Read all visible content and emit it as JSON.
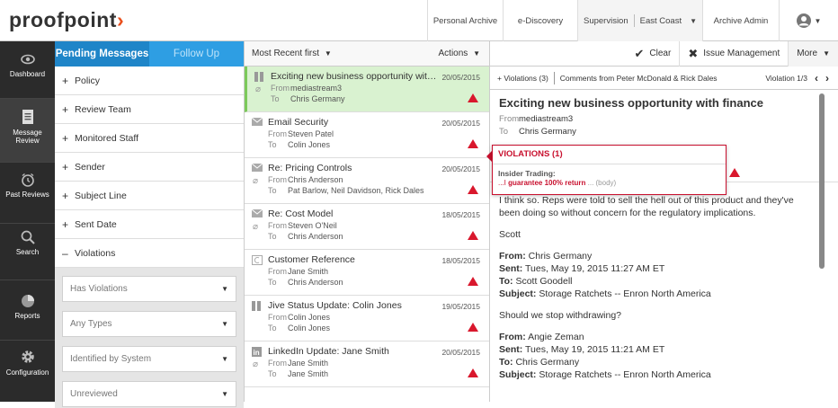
{
  "brand": {
    "name": "proofpoint",
    "mark": "›"
  },
  "topnav": {
    "personal_archive": "Personal Archive",
    "ediscovery": "e-Discovery",
    "supervision": "Supervision",
    "region": "East Coast",
    "archive_admin": "Archive Admin"
  },
  "leftnav": {
    "dashboard": "Dashboard",
    "message_review_1": "Message",
    "message_review_2": "Review",
    "past_reviews": "Past Reviews",
    "search": "Search",
    "reports": "Reports",
    "configuration": "Configuration"
  },
  "filters": {
    "tab_pending": "Pending Messages",
    "tab_followup": "Follow Up",
    "rows": [
      {
        "sign": "+",
        "label": "Policy"
      },
      {
        "sign": "+",
        "label": "Review Team"
      },
      {
        "sign": "+",
        "label": "Monitored Staff"
      },
      {
        "sign": "+",
        "label": "Sender"
      },
      {
        "sign": "+",
        "label": "Subject Line"
      },
      {
        "sign": "+",
        "label": "Sent Date"
      },
      {
        "sign": "–",
        "label": "Violations"
      }
    ],
    "selects": [
      "Has Violations",
      "Any Types",
      "Identified by System",
      "Unreviewed"
    ]
  },
  "list": {
    "sort": "Most Recent first",
    "actions": "Actions",
    "from_label": "From",
    "to_label": "To",
    "messages": [
      {
        "subject": "Exciting new business opportunity with fin...",
        "date": "20/05/2015",
        "from": "mediastream3",
        "to": "Chris Germany",
        "clip": true,
        "icon": "doc-icon"
      },
      {
        "subject": "Email Security",
        "date": "20/05/2015",
        "from": "Steven Patel",
        "to": "Colin Jones",
        "clip": false,
        "icon": "mail-icon"
      },
      {
        "subject": "Re: Pricing Controls",
        "date": "20/05/2015",
        "from": "Chris Anderson",
        "to": "Pat Barlow, Neil Davidson, Rick Dales",
        "clip": true,
        "icon": "mail-icon"
      },
      {
        "subject": "Re: Cost Model",
        "date": "18/05/2015",
        "from": "Steven O'Neil",
        "to": "Chris Anderson",
        "clip": true,
        "icon": "mail-icon"
      },
      {
        "subject": "Customer Reference",
        "date": "18/05/2015",
        "from": "Jane Smith",
        "to": "Chris Anderson",
        "clip": false,
        "icon": "chat-icon"
      },
      {
        "subject": "Jive Status Update: Colin Jones",
        "date": "19/05/2015",
        "from": "Colin Jones",
        "to": "Colin Jones",
        "clip": false,
        "icon": "doc-icon"
      },
      {
        "subject": "LinkedIn Update: Jane Smith",
        "date": "20/05/2015",
        "from": "Jane Smith",
        "to": "Jane Smith",
        "clip": true,
        "icon": "linkedin-icon"
      }
    ]
  },
  "toolbar": {
    "clear": "Clear",
    "issue": "Issue Management",
    "more": "More"
  },
  "reader": {
    "tab_violations": "+ Violations (3)",
    "tab_comments": "Comments from Peter McDonald & Rick Dales",
    "violation_counter": "Violation 1/3",
    "subject": "Exciting new business opportunity with finance",
    "from_label": "From",
    "to_label": "To",
    "from": "mediastream3",
    "to": "Chris Germany",
    "body": {
      "line1": "I think so. Reps were told to sell the hell out of this product and they've been doing so without concern for the regulatory implications.",
      "sign": "Scott",
      "f1_from_k": "From:",
      "f1_from_v": "Chris Germany",
      "f1_sent_k": "Sent:",
      "f1_sent_v": "Tues, May 19, 2015 11:27 AM ET",
      "f1_to_k": "To:",
      "f1_to_v": "Scott Goodell",
      "f1_subj_k": "Subject:",
      "f1_subj_v": "Storage Ratchets -- Enron North America",
      "question": "Should we stop withdrawing?",
      "f2_from_k": "From:",
      "f2_from_v": "Angie Zeman",
      "f2_sent_k": "Sent:",
      "f2_sent_v": "Tues, May 19, 2015 11:21 AM ET",
      "f2_to_k": "To:",
      "f2_to_v": "Chris Germany",
      "f2_subj_k": "Subject:",
      "f2_subj_v": "Storage Ratchets -- Enron North America"
    }
  },
  "popup": {
    "title": "VIOLATIONS (1)",
    "category": "Insider Trading:",
    "pre": "...I",
    "match": "guarantee 100% return",
    "post": "... (body)"
  },
  "colors": {
    "accent": "#2e9ee3",
    "violation": "#d9182d",
    "selected": "#d9f2d0"
  }
}
